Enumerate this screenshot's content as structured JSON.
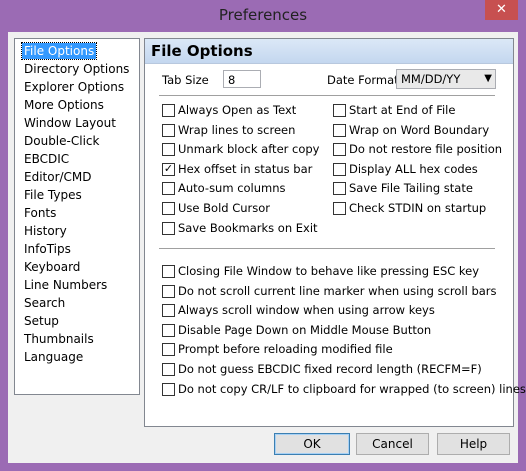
{
  "window": {
    "title": "Preferences",
    "close_glyph": "✕"
  },
  "sidebar": {
    "items": [
      {
        "label": "File Options",
        "selected": true
      },
      {
        "label": "Directory Options"
      },
      {
        "label": "Explorer Options"
      },
      {
        "label": "More Options"
      },
      {
        "label": "Window Layout"
      },
      {
        "label": "Double-Click"
      },
      {
        "label": "EBCDIC"
      },
      {
        "label": "Editor/CMD"
      },
      {
        "label": "File Types"
      },
      {
        "label": "Fonts"
      },
      {
        "label": "History"
      },
      {
        "label": "InfoTips"
      },
      {
        "label": "Keyboard"
      },
      {
        "label": "Line Numbers"
      },
      {
        "label": "Search"
      },
      {
        "label": "Setup"
      },
      {
        "label": "Thumbnails"
      },
      {
        "label": "Language"
      }
    ]
  },
  "panel": {
    "title": "File Options",
    "tab_size_label": "Tab Size",
    "tab_size_value": "8",
    "date_format_label": "Date Format",
    "date_format_value": "MM/DD/YY",
    "left_checks": [
      {
        "label": "Always Open as Text",
        "checked": false
      },
      {
        "label": "Wrap lines to screen",
        "checked": false
      },
      {
        "label": "Unmark block after copy",
        "checked": false
      },
      {
        "label": "Hex offset in status bar",
        "checked": true
      },
      {
        "label": "Auto-sum columns",
        "checked": false
      },
      {
        "label": "Use Bold Cursor",
        "checked": false
      },
      {
        "label": "Save Bookmarks on Exit",
        "checked": false
      }
    ],
    "right_checks": [
      {
        "label": "Start at End of File",
        "checked": false
      },
      {
        "label": "Wrap on Word Boundary",
        "checked": false
      },
      {
        "label": "Do not restore file position",
        "checked": false
      },
      {
        "label": "Display ALL hex codes",
        "checked": false
      },
      {
        "label": "Save File Tailing state",
        "checked": false
      },
      {
        "label": "Check STDIN on startup",
        "checked": false
      }
    ],
    "bottom_checks": [
      {
        "label": "Closing File Window to behave like pressing ESC key",
        "checked": false
      },
      {
        "label": "Do not scroll current line marker when using scroll bars",
        "checked": false
      },
      {
        "label": "Always scroll window when using arrow keys",
        "checked": false
      },
      {
        "label": "Disable Page Down on Middle Mouse Button",
        "checked": false
      },
      {
        "label": "Prompt before reloading modified file",
        "checked": false
      },
      {
        "label": "Do not guess EBCDIC fixed record length (RECFM=F)",
        "checked": false
      },
      {
        "label": "Do not copy CR/LF to clipboard for wrapped (to screen) lines",
        "checked": false
      }
    ]
  },
  "buttons": {
    "ok": "OK",
    "cancel": "Cancel",
    "help": "Help"
  }
}
